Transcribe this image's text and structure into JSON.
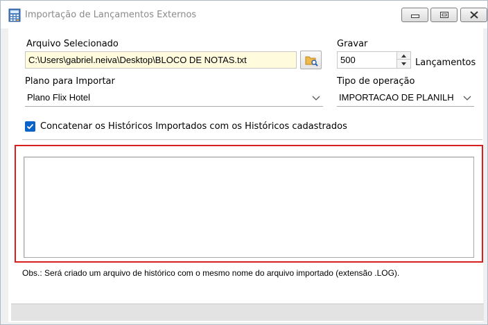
{
  "window": {
    "title": "Importação de Lançamentos Externos"
  },
  "file": {
    "label": "Arquivo Selecionado",
    "value": "C:\\Users\\gabriel.neiva\\Desktop\\BLOCO DE NOTAS.txt",
    "browse_icon": "folder-search-icon"
  },
  "gravar": {
    "label": "Gravar",
    "value": "500",
    "suffix": "Lançamentos"
  },
  "plano": {
    "label": "Plano para Importar",
    "selected": "Plano Flix Hotel"
  },
  "tipo": {
    "label": "Tipo de operação",
    "selected": "IMPORTACAO DE PLANILH"
  },
  "concat": {
    "label": "Concatenar os Históricos Importados com os Históricos cadastrados",
    "checked": true
  },
  "log": {
    "content": ""
  },
  "obs": {
    "text": "Obs.: Será criado um arquivo de histórico com o mesmo nome do arquivo importado (extensão .LOG)."
  },
  "colors": {
    "accent": "#0a63c9",
    "highlight_border": "#d81e1e",
    "file_field_bg": "#fffbdc"
  }
}
